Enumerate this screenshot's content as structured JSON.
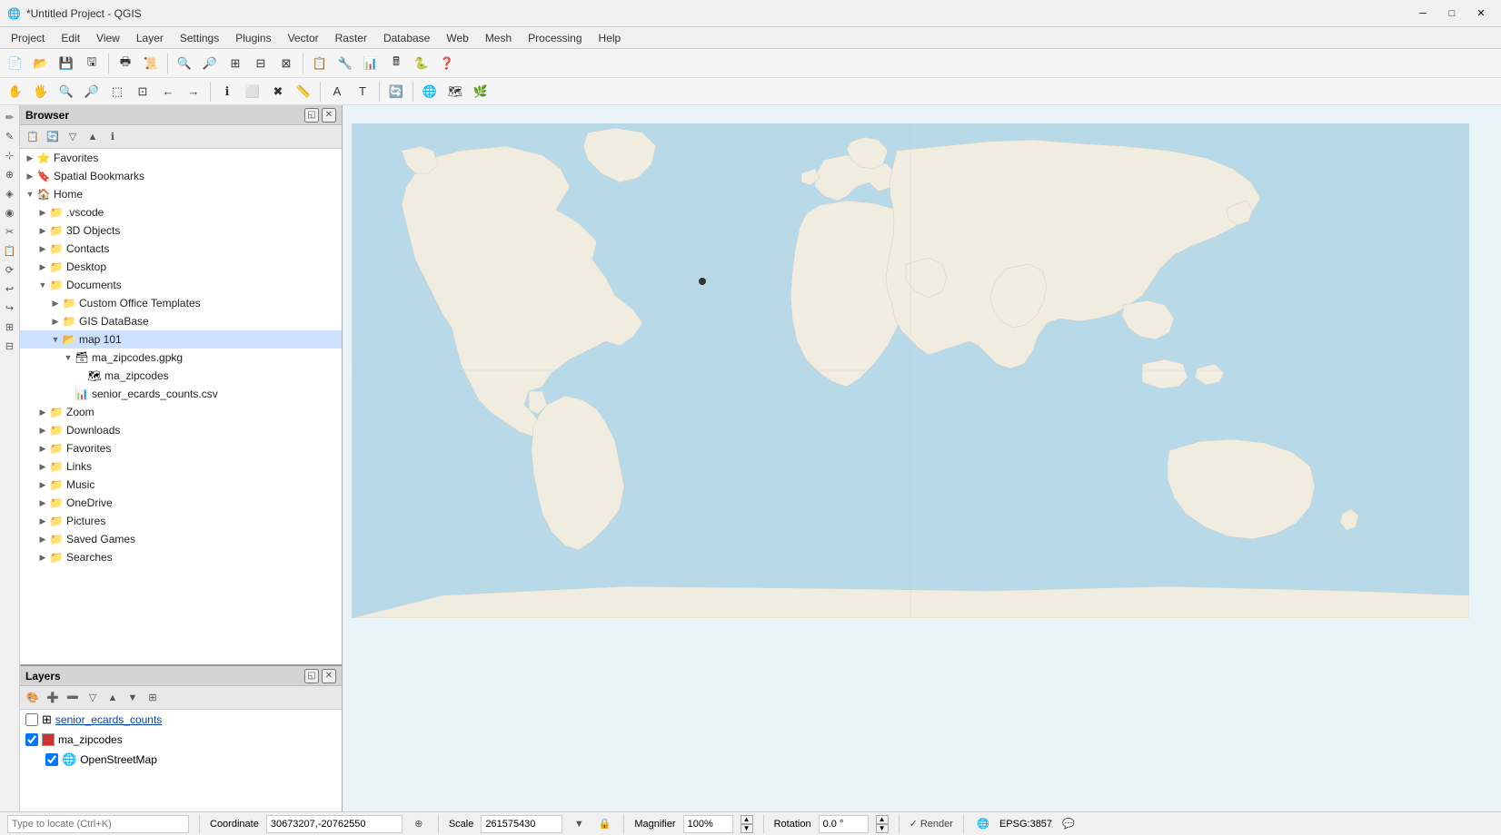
{
  "titlebar": {
    "title": "*Untitled Project - QGIS",
    "icon": "🌐",
    "minimize_label": "─",
    "maximize_label": "□",
    "close_label": "✕"
  },
  "menubar": {
    "items": [
      {
        "id": "menu-project",
        "label": "Project"
      },
      {
        "id": "menu-edit",
        "label": "Edit"
      },
      {
        "id": "menu-view",
        "label": "View"
      },
      {
        "id": "menu-layer",
        "label": "Layer"
      },
      {
        "id": "menu-settings",
        "label": "Settings"
      },
      {
        "id": "menu-plugins",
        "label": "Plugins"
      },
      {
        "id": "menu-vector",
        "label": "Vector"
      },
      {
        "id": "menu-raster",
        "label": "Raster"
      },
      {
        "id": "menu-database",
        "label": "Database"
      },
      {
        "id": "menu-web",
        "label": "Web"
      },
      {
        "id": "menu-mesh",
        "label": "Mesh"
      },
      {
        "id": "menu-processing",
        "label": "Processing"
      },
      {
        "id": "menu-help",
        "label": "Help"
      }
    ]
  },
  "toolbar1": {
    "buttons": [
      {
        "id": "tb-new",
        "icon": "📄",
        "label": "New"
      },
      {
        "id": "tb-open",
        "icon": "📂",
        "label": "Open"
      },
      {
        "id": "tb-save",
        "icon": "💾",
        "label": "Save"
      },
      {
        "id": "tb-save-as",
        "icon": "🖫",
        "label": "Save As"
      },
      {
        "id": "tb-print",
        "icon": "🖶",
        "label": "Print"
      }
    ]
  },
  "browser": {
    "title": "Browser",
    "toolbar_buttons": [
      {
        "id": "br-add",
        "icon": "📋",
        "label": "Add"
      },
      {
        "id": "br-refresh",
        "icon": "🔄",
        "label": "Refresh"
      },
      {
        "id": "br-filter",
        "icon": "🔽",
        "label": "Filter"
      },
      {
        "id": "br-collapse",
        "icon": "▲",
        "label": "Collapse"
      },
      {
        "id": "br-info",
        "icon": "ℹ",
        "label": "Info"
      }
    ],
    "tree": [
      {
        "id": "node-favorites",
        "label": "Favorites",
        "icon": "⭐",
        "level": 0,
        "expanded": false,
        "arrow": "▶"
      },
      {
        "id": "node-bookmarks",
        "label": "Spatial Bookmarks",
        "icon": "🔖",
        "level": 0,
        "expanded": false,
        "arrow": "▶"
      },
      {
        "id": "node-home",
        "label": "Home",
        "icon": "🏠",
        "level": 0,
        "expanded": true,
        "arrow": "▼"
      },
      {
        "id": "node-vscode",
        "label": ".vscode",
        "icon": "📁",
        "level": 1,
        "expanded": false,
        "arrow": "▶"
      },
      {
        "id": "node-3d",
        "label": "3D Objects",
        "icon": "📁",
        "level": 1,
        "expanded": false,
        "arrow": "▶"
      },
      {
        "id": "node-contacts",
        "label": "Contacts",
        "icon": "📁",
        "level": 1,
        "expanded": false,
        "arrow": "▶"
      },
      {
        "id": "node-desktop",
        "label": "Desktop",
        "icon": "📁",
        "level": 1,
        "expanded": false,
        "arrow": "▶"
      },
      {
        "id": "node-documents",
        "label": "Documents",
        "icon": "📁",
        "level": 1,
        "expanded": true,
        "arrow": "▼"
      },
      {
        "id": "node-custom-office",
        "label": "Custom Office Templates",
        "icon": "📁",
        "level": 2,
        "expanded": false,
        "arrow": "▶"
      },
      {
        "id": "node-gis",
        "label": "GIS DataBase",
        "icon": "📁",
        "level": 2,
        "expanded": false,
        "arrow": "▶"
      },
      {
        "id": "node-map101",
        "label": "map 101",
        "icon": "📂",
        "level": 2,
        "expanded": true,
        "arrow": "▼",
        "selected": true
      },
      {
        "id": "node-gpkg",
        "label": "ma_zipcodes.gpkg",
        "icon": "🗃",
        "level": 3,
        "expanded": true,
        "arrow": "▼"
      },
      {
        "id": "node-mazip",
        "label": "ma_zipcodes",
        "icon": "🗺",
        "level": 4,
        "expanded": false,
        "arrow": ""
      },
      {
        "id": "node-csv",
        "label": "senior_ecards_counts.csv",
        "icon": "📊",
        "level": 3,
        "expanded": false,
        "arrow": ""
      },
      {
        "id": "node-zoom",
        "label": "Zoom",
        "icon": "📁",
        "level": 1,
        "expanded": false,
        "arrow": "▶"
      },
      {
        "id": "node-downloads",
        "label": "Downloads",
        "icon": "📁",
        "level": 1,
        "expanded": false,
        "arrow": "▶"
      },
      {
        "id": "node-favorites2",
        "label": "Favorites",
        "icon": "📁",
        "level": 1,
        "expanded": false,
        "arrow": "▶"
      },
      {
        "id": "node-links",
        "label": "Links",
        "icon": "📁",
        "level": 1,
        "expanded": false,
        "arrow": "▶"
      },
      {
        "id": "node-music",
        "label": "Music",
        "icon": "📁",
        "level": 1,
        "expanded": false,
        "arrow": "▶"
      },
      {
        "id": "node-onedrive",
        "label": "OneDrive",
        "icon": "📁",
        "level": 1,
        "expanded": false,
        "arrow": "▶"
      },
      {
        "id": "node-pictures",
        "label": "Pictures",
        "icon": "📁",
        "level": 1,
        "expanded": false,
        "arrow": "▶"
      },
      {
        "id": "node-savedgames",
        "label": "Saved Games",
        "icon": "📁",
        "level": 1,
        "expanded": false,
        "arrow": "▶"
      },
      {
        "id": "node-searches",
        "label": "Searches",
        "icon": "📁",
        "level": 1,
        "expanded": false,
        "arrow": "▶"
      }
    ]
  },
  "layers": {
    "title": "Layers",
    "items": [
      {
        "id": "layer-senior",
        "label": "senior_ecards_counts",
        "type": "table",
        "visible": false,
        "color": null,
        "underline": true
      },
      {
        "id": "layer-mazip",
        "label": "ma_zipcodes",
        "type": "polygon",
        "visible": true,
        "color": "#cc3333"
      },
      {
        "id": "layer-osm",
        "label": "OpenStreetMap",
        "type": "raster",
        "visible": true,
        "color": null,
        "indent": true
      }
    ]
  },
  "statusbar": {
    "coordinate_label": "Coordinate",
    "coordinate_value": "30673207,-20762550",
    "scale_label": "Scale",
    "scale_value": "261575430",
    "magnifier_label": "Magnifier",
    "magnifier_value": "100%",
    "rotation_label": "Rotation",
    "rotation_value": "0.0 °",
    "render_label": "✓ Render",
    "epsg_label": "EPSG:3857",
    "message_icon": "💬"
  },
  "locatebar": {
    "placeholder": "Type to locate (Ctrl+K)"
  }
}
